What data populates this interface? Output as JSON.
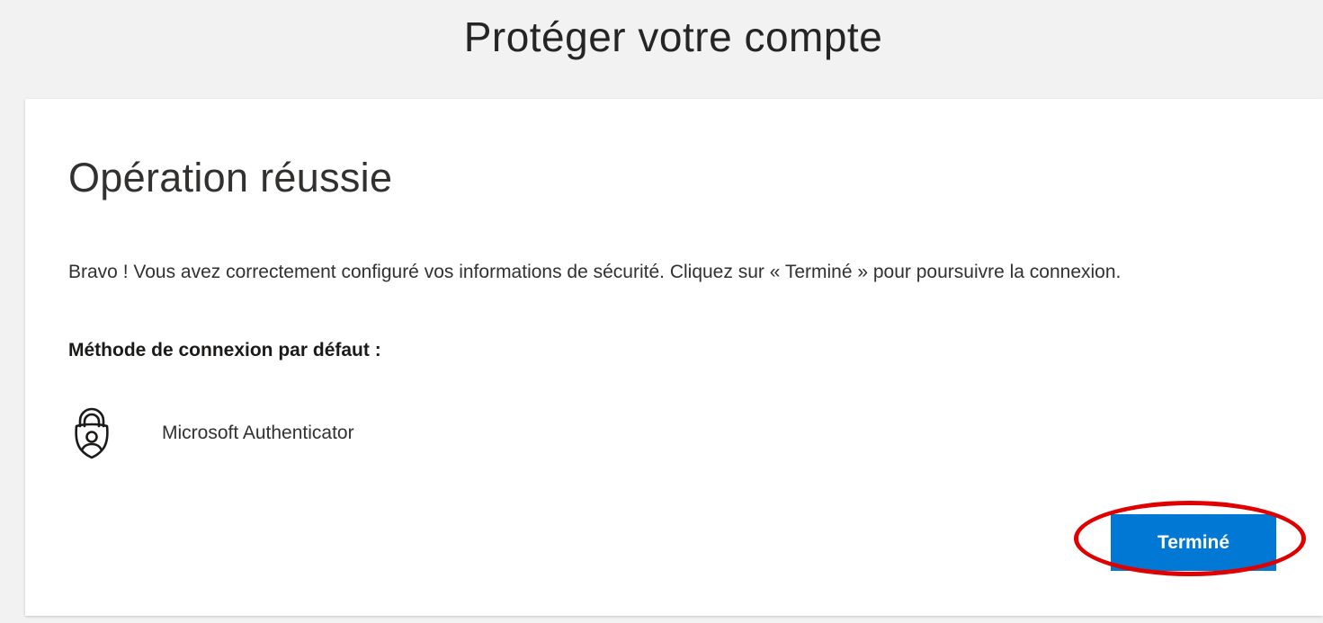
{
  "header": {
    "title": "Protéger votre compte"
  },
  "card": {
    "heading": "Opération réussie",
    "message": "Bravo ! Vous avez correctement configuré vos informations de sécurité. Cliquez sur « Terminé » pour poursuivre la connexion.",
    "default_method_label": "Méthode de connexion par défaut :",
    "default_method": {
      "name": "Microsoft Authenticator",
      "icon": "authenticator-lock-icon"
    },
    "done_button_label": "Terminé"
  },
  "colors": {
    "accent": "#0078d4",
    "highlight": "#e00000",
    "background": "#f2f2f2"
  }
}
